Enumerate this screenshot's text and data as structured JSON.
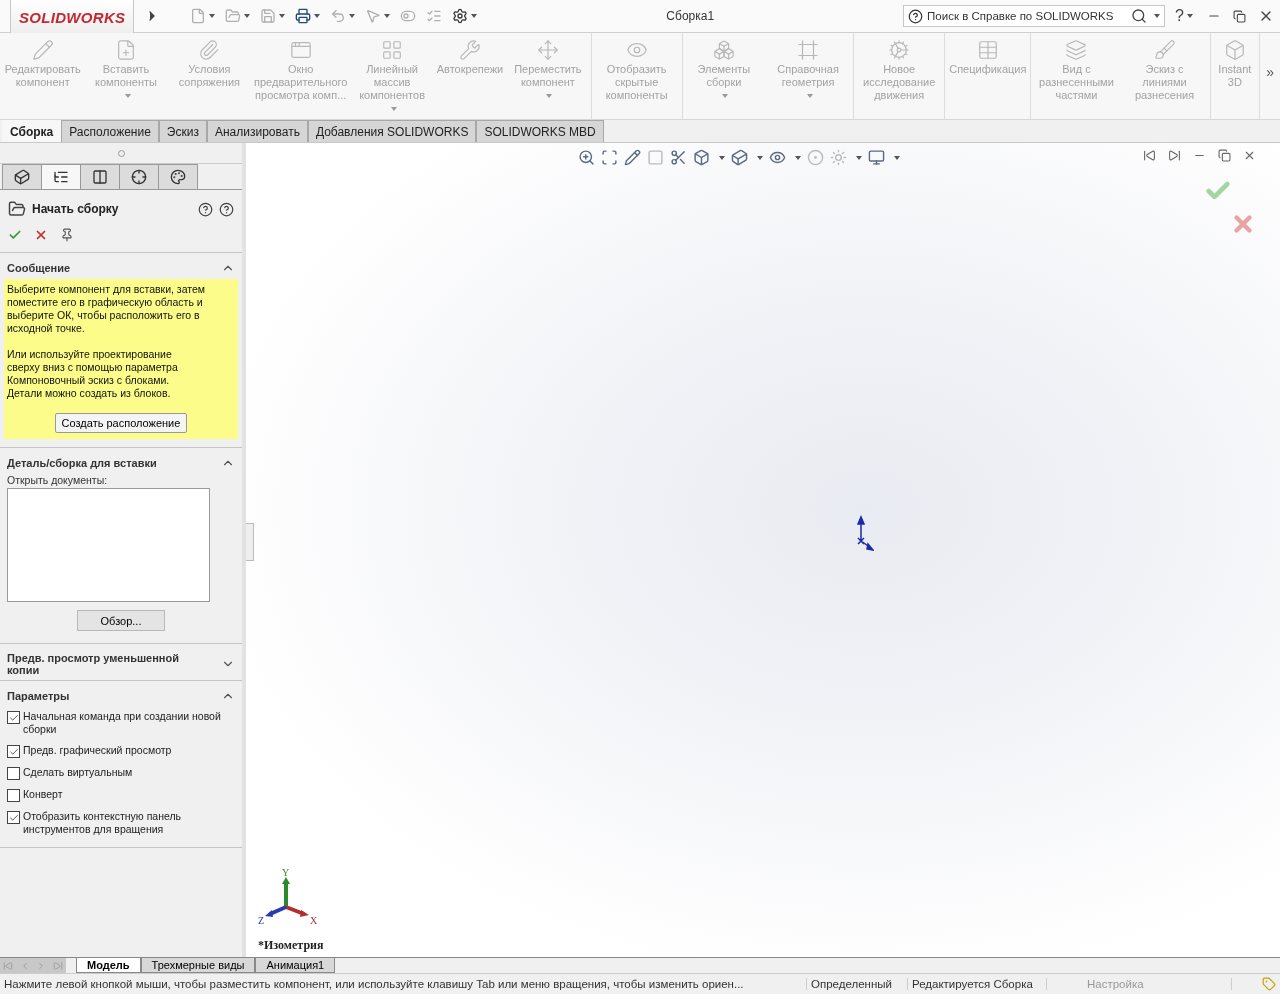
{
  "titlebar": {
    "logo": "SOLIDWORKS",
    "title": "Сборка1",
    "search": {
      "placeholder": "Поиск в Справке по SOLIDWORKS"
    },
    "help": "?"
  },
  "ribbon": {
    "groups": [
      {
        "items": [
          {
            "label": "Редактировать компонент",
            "has_menu": false,
            "disabled": true
          },
          {
            "label": "Вставить компоненты",
            "has_menu": true,
            "disabled": true
          },
          {
            "label": "Условия сопряжения",
            "has_menu": false,
            "disabled": true
          },
          {
            "label": "Окно предварительного просмотра комп...",
            "has_menu": false,
            "disabled": true
          },
          {
            "label": "Линейный массив компонентов",
            "has_menu": true,
            "disabled": true
          },
          {
            "label": "Автокрепежи",
            "has_menu": false,
            "disabled": true
          },
          {
            "label": "Переместить компонент",
            "has_menu": true,
            "disabled": true
          }
        ]
      },
      {
        "items": [
          {
            "label": "Отобразить скрытые компоненты",
            "has_menu": false,
            "disabled": true
          }
        ]
      },
      {
        "items": [
          {
            "label": "Элементы сборки",
            "has_menu": true,
            "disabled": true
          },
          {
            "label": "Справочная геометрия",
            "has_menu": true,
            "disabled": true
          }
        ]
      },
      {
        "items": [
          {
            "label": "Новое исследование движения",
            "has_menu": false,
            "disabled": true
          }
        ]
      },
      {
        "items": [
          {
            "label": "Спецификация",
            "has_menu": false,
            "disabled": true
          }
        ]
      },
      {
        "items": [
          {
            "label": "Вид с разнесенными частями",
            "has_menu": false,
            "disabled": true
          },
          {
            "label": "Эскиз с линиями разнесения",
            "has_menu": false,
            "disabled": true
          }
        ]
      },
      {
        "items": [
          {
            "label": "Instant 3D",
            "has_menu": false,
            "disabled": true
          }
        ]
      }
    ],
    "overflow": "»"
  },
  "tabs": [
    {
      "label": "Сборка",
      "selected": true
    },
    {
      "label": "Расположение",
      "selected": false
    },
    {
      "label": "Эскиз",
      "selected": false
    },
    {
      "label": "Анализировать",
      "selected": false
    },
    {
      "label": "Добавления SOLIDWORKS",
      "selected": false
    },
    {
      "label": "SOLIDWORKS MBD",
      "selected": false
    }
  ],
  "panel_tabs": [
    {
      "selected": false
    },
    {
      "selected": true
    },
    {
      "selected": false
    },
    {
      "selected": false
    },
    {
      "selected": false
    }
  ],
  "property_manager": {
    "title": "Начать сборку",
    "sections": [
      {
        "kind": "message",
        "title": "Сообщение",
        "expanded": true,
        "paragraphs": [
          "Выберите компонент для вставки, затем поместите его в графическую область и выберите ОК, чтобы расположить его в исходной точке.",
          "Или используйте проектирование сверху вниз с помощью параметра Компоновочный эскиз с блоками. Детали можно создать из блоков."
        ],
        "button": "Создать расположение"
      },
      {
        "kind": "insert",
        "title": "Деталь/сборка для вставки",
        "expanded": true,
        "list_label": "Открыть документы:",
        "button": "Обзор..."
      },
      {
        "kind": "preview",
        "title": "Предв. просмотр уменьшенной копии",
        "expanded": false
      },
      {
        "kind": "options",
        "title": "Параметры",
        "expanded": true,
        "options": [
          {
            "label": "Начальная команда при создании новой сборки",
            "checked": true
          },
          {
            "label": "Предв. графический просмотр",
            "checked": true
          },
          {
            "label": "Сделать виртуальным",
            "checked": false
          },
          {
            "label": "Конверт",
            "checked": false
          },
          {
            "label": "Отобразить контекстную панель инструментов для вращения",
            "checked": true
          }
        ]
      }
    ]
  },
  "viewport": {
    "view_name": "*Изометрия",
    "triad": {
      "x": "X",
      "y": "Y",
      "z": "Z"
    }
  },
  "bottom_tabs": [
    {
      "label": "Модель",
      "selected": true
    },
    {
      "label": "Трехмерные виды",
      "selected": false
    },
    {
      "label": "Анимация1",
      "selected": false
    }
  ],
  "status_bar": {
    "message": "Нажмите левой кнопкой мыши, чтобы разместить компонент, или используйте клавишу Tab или меню вращения, чтобы изменить ориен...",
    "state": "Определенный",
    "mode": "Редактируется Сборка",
    "units": "Настройка"
  }
}
